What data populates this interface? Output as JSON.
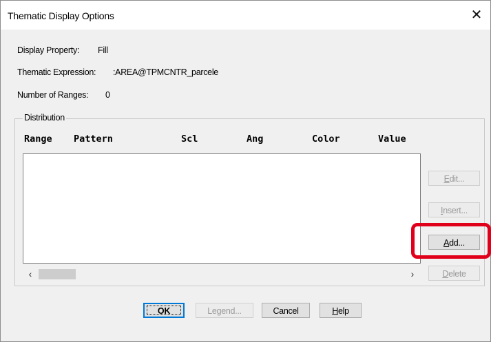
{
  "window": {
    "title": "Thematic Display Options"
  },
  "info": {
    "display_property_label": "Display Property:",
    "display_property_value": "Fill",
    "thematic_expression_label": "Thematic Expression:",
    "thematic_expression_value": ":AREA@TPMCNTR_parcele",
    "number_of_ranges_label": "Number of Ranges:",
    "number_of_ranges_value": "0"
  },
  "distribution": {
    "group_label": "Distribution",
    "columns": [
      "Range",
      "Pattern",
      "Scl",
      "Ang",
      "Color",
      "Value"
    ],
    "rows": []
  },
  "side_buttons": {
    "edit": {
      "prefix": "",
      "mnemonic": "E",
      "rest": "dit...",
      "enabled": false
    },
    "insert": {
      "prefix": "",
      "mnemonic": "I",
      "rest": "nsert...",
      "enabled": false
    },
    "add": {
      "prefix": "",
      "mnemonic": "A",
      "rest": "dd...",
      "enabled": true,
      "highlighted": true
    },
    "delete": {
      "prefix": "",
      "mnemonic": "D",
      "rest": "elete",
      "enabled": false
    }
  },
  "bottom_buttons": {
    "ok": {
      "label": "OK",
      "enabled": true,
      "default": true
    },
    "legend": {
      "label": "Legend...",
      "enabled": false
    },
    "cancel": {
      "label": "Cancel",
      "enabled": true
    },
    "help": {
      "mnemonic": "H",
      "rest": "elp",
      "enabled": true
    }
  },
  "icons": {
    "close": "close-icon",
    "scroll_left": "chevron-left-icon",
    "scroll_right": "chevron-right-icon"
  },
  "colors": {
    "highlight": "#e0001b",
    "dialog_bg": "#f0f0f0",
    "focus": "#0078d7"
  }
}
